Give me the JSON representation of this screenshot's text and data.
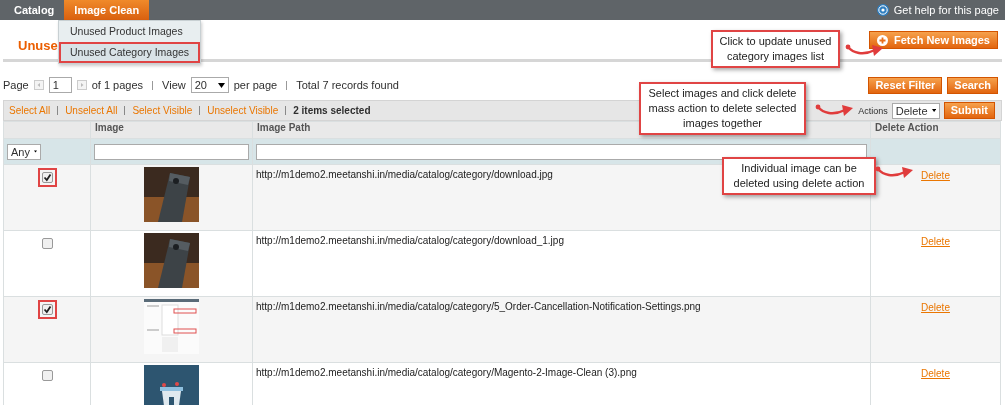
{
  "top_nav": {
    "items": [
      {
        "label": "Catalog",
        "selected": false
      },
      {
        "label": "Image Clean",
        "selected": true
      }
    ],
    "help_link": "Get help for this page"
  },
  "dropdown_menu": {
    "items": [
      {
        "label": "Unused Product Images",
        "highlighted": false
      },
      {
        "label": "Unused Category Images",
        "highlighted": true
      }
    ]
  },
  "page_title": "Unuse",
  "fetch_button": "Fetch New Images",
  "pager": {
    "page_label": "Page",
    "page_value": "1",
    "of_pages": "of 1 pages",
    "view_label": "View",
    "per_page_value": "20",
    "per_page_label": "per page",
    "total": "Total 7 records found"
  },
  "buttons": [
    "Reset Filter",
    "Search"
  ],
  "massaction": {
    "links": [
      "Select All",
      "Unselect All",
      "Select Visible",
      "Unselect Visible"
    ],
    "selected_count": "2 items selected",
    "actions_label": "Actions",
    "action_value": "Delete",
    "submit": "Submit"
  },
  "table": {
    "columns": [
      "Image",
      "Image Path",
      "Delete Action"
    ],
    "filter_select": "Any",
    "rows": [
      {
        "checked": true,
        "path": "http://m1demo2.meetanshi.in/media/catalog/category/download.jpg",
        "action": "Delete"
      },
      {
        "checked": false,
        "path": "http://m1demo2.meetanshi.in/media/catalog/category/download_1.jpg",
        "action": "Delete"
      },
      {
        "checked": true,
        "path": "http://m1demo2.meetanshi.in/media/catalog/category/5_Order-Cancellation-Notification-Settings.png",
        "action": "Delete"
      },
      {
        "checked": false,
        "path": "http://m1demo2.meetanshi.in/media/catalog/category/Magento-2-Image-Clean (3).png",
        "action": "Delete"
      }
    ]
  },
  "callouts": [
    {
      "text": "Click to update unused category images list"
    },
    {
      "text": "Select images and click delete mass action to delete selected images together"
    },
    {
      "text": "Individual image can be deleted using delete action"
    }
  ]
}
